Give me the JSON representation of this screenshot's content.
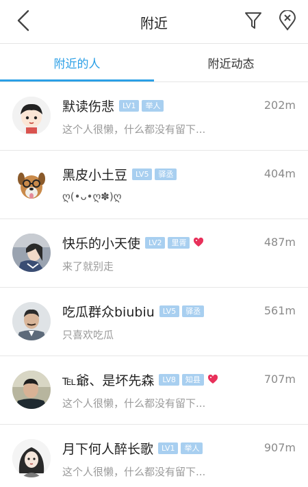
{
  "header": {
    "title": "附近",
    "back_icon": "chevron-left-icon",
    "filter_icon": "filter-funnel-icon",
    "location_off_icon": "location-off-icon"
  },
  "tabs": [
    {
      "label": "附近的人",
      "active": true
    },
    {
      "label": "附近动态",
      "active": false
    }
  ],
  "colors": {
    "accent": "#2b9fe6",
    "badge": "#a8cff0",
    "heart": "#e8305a",
    "secondary_text": "#9a9a9a"
  },
  "people": [
    {
      "name": "默读伤悲",
      "level": "LV1",
      "rank": "举人",
      "heart": false,
      "distance": "202m",
      "desc": "这个人很懒，什么都没有留下..."
    },
    {
      "name": "黑皮小土豆",
      "level": "LV5",
      "rank": "驿丞",
      "heart": false,
      "distance": "404m",
      "desc": "ღ(•ᴗ•ღ✽)ღ"
    },
    {
      "name": "快乐的小天使",
      "level": "LV2",
      "rank": "里胥",
      "heart": true,
      "distance": "487m",
      "desc": "来了就别走"
    },
    {
      "name": "吃瓜群众biubiu",
      "level": "LV5",
      "rank": "驿丞",
      "heart": false,
      "distance": "561m",
      "desc": "只喜欢吃瓜"
    },
    {
      "name": "℡爺、是坏先森",
      "level": "LV8",
      "rank": "知县",
      "heart": true,
      "distance": "707m",
      "desc": "这个人很懒，什么都没有留下..."
    },
    {
      "name": "月下何人醉长歌",
      "level": "LV1",
      "rank": "举人",
      "heart": false,
      "distance": "907m",
      "desc": "这个人很懒，什么都没有留下..."
    }
  ]
}
